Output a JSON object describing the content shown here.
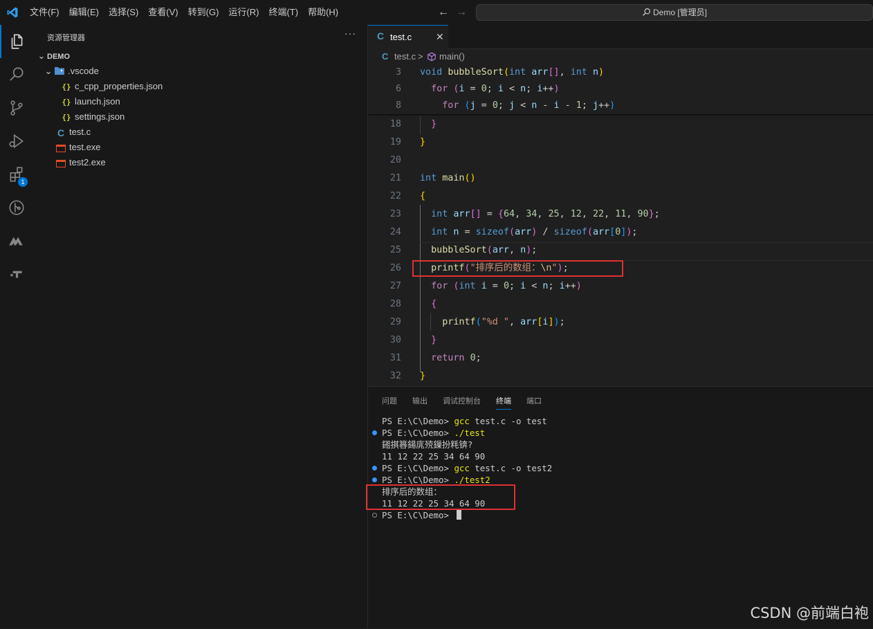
{
  "titlebar": {
    "menu": [
      "文件(F)",
      "编辑(E)",
      "选择(S)",
      "查看(V)",
      "转到(G)",
      "运行(R)",
      "终端(T)",
      "帮助(H)"
    ],
    "search_label": "Demo [管理员]"
  },
  "activitybar": {
    "extensions_badge": "1"
  },
  "sidebar": {
    "title": "资源管理器",
    "more": "···",
    "root": "DEMO",
    "folder": ".vscode",
    "files": {
      "c_cpp_properties": "c_cpp_properties.json",
      "launch": "launch.json",
      "settings": "settings.json",
      "testc": "test.c",
      "testexe": "test.exe",
      "test2exe": "test2.exe"
    }
  },
  "tab": {
    "label": "test.c",
    "close": "✕"
  },
  "breadcrumb": {
    "file": "test.c",
    "separator": ">",
    "symbol": "main()"
  },
  "editor": {
    "lines": [
      {
        "n": "3"
      },
      {
        "n": "6"
      },
      {
        "n": "8"
      },
      {
        "n": "18"
      },
      {
        "n": "19"
      },
      {
        "n": "20"
      },
      {
        "n": "21"
      },
      {
        "n": "22"
      },
      {
        "n": "23"
      },
      {
        "n": "24"
      },
      {
        "n": "25"
      },
      {
        "n": "26"
      },
      {
        "n": "27"
      },
      {
        "n": "28"
      },
      {
        "n": "29"
      },
      {
        "n": "30"
      },
      {
        "n": "31"
      },
      {
        "n": "32"
      }
    ]
  },
  "panel": {
    "tabs": [
      "问题",
      "输出",
      "调试控制台",
      "终端",
      "端口"
    ],
    "terminal": [
      {
        "prompt": "PS E:\\C\\Demo> ",
        "cmd": "gcc",
        "args": " test.c -o test"
      },
      {
        "prompt": "PS E:\\C\\Demo> ",
        "cmd": "./test",
        "args": ""
      },
      {
        "text": "鎺掑簭鍚庣殑鏁扮粍锛?"
      },
      {
        "text": "11 12 22 25 34 64 90"
      },
      {
        "prompt": "PS E:\\C\\Demo> ",
        "cmd": "gcc",
        "args": " test.c -o test2"
      },
      {
        "prompt": "PS E:\\C\\Demo> ",
        "cmd": "./test2",
        "args": ""
      },
      {
        "text": "排序后的数组："
      },
      {
        "text": "11 12 22 25 34 64 90"
      },
      {
        "prompt": "PS E:\\C\\Demo> "
      }
    ]
  },
  "watermark": "CSDN @前端白袍",
  "colors": {
    "accent": "#0078d4",
    "highlight_box": "#e03131"
  }
}
